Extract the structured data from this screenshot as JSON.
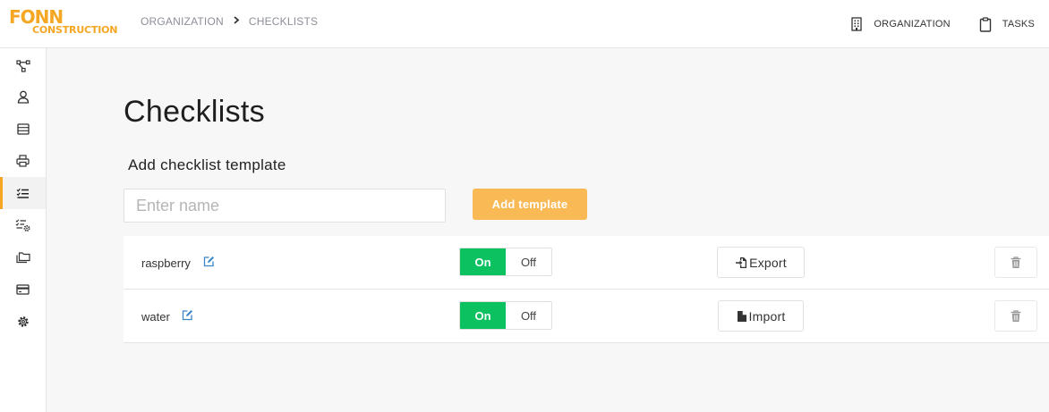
{
  "logo": {
    "top": "FONN",
    "bottom": "CONSTRUCTION"
  },
  "breadcrumb": {
    "items": [
      "ORGANIZATION",
      "CHECKLISTS"
    ],
    "separator": "›"
  },
  "header": {
    "organization_label": "ORGANIZATION",
    "tasks_label": "TASKS"
  },
  "sidebar": {
    "items": [
      {
        "icon": "workflow-icon"
      },
      {
        "icon": "user-icon"
      },
      {
        "icon": "database-icon"
      },
      {
        "icon": "printer-icon"
      },
      {
        "icon": "checklist-icon",
        "active": true
      },
      {
        "icon": "checklist-settings-icon"
      },
      {
        "icon": "folders-icon"
      },
      {
        "icon": "credit-card-icon"
      },
      {
        "icon": "gear-icon"
      }
    ]
  },
  "main": {
    "title": "Checklists",
    "section_title": "Add checklist template",
    "name_input": {
      "placeholder": "Enter name",
      "value": ""
    },
    "add_button": "Add template"
  },
  "checklists": [
    {
      "name": "raspberry",
      "toggle_on": "On",
      "toggle_off": "Off",
      "state": "On",
      "action": "Export",
      "action_icon": "export-icon"
    },
    {
      "name": "water",
      "toggle_on": "On",
      "toggle_off": "Off",
      "state": "On",
      "action": "Import",
      "action_icon": "file-icon"
    }
  ],
  "colors": {
    "brand": "#f5a623",
    "add_button": "#f9b955",
    "toggle_on": "#0bc160",
    "edit_icon": "#3a86c8"
  }
}
